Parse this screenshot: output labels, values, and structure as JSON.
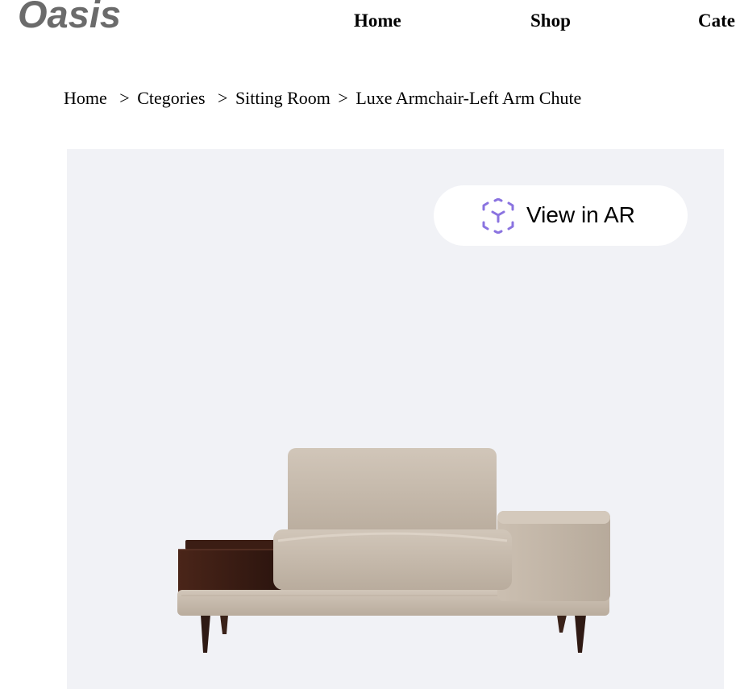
{
  "header": {
    "logo": "Oasis",
    "nav": {
      "home": "Home",
      "shop": "Shop",
      "categories": "Cate"
    }
  },
  "breadcrumb": {
    "items": [
      "Home",
      "Ctegories",
      "Sitting Room",
      "Luxe Armchair-Left Arm Chute"
    ],
    "separator": ">"
  },
  "product": {
    "ar_button_label": "View in AR",
    "ar_icon": "ar-cube-icon",
    "image": "armchair-photo",
    "colors": {
      "stage_background": "#f1f2f6",
      "ar_icon_accent": "#8a73e0",
      "upholstery": "#c8bcae",
      "wood": "#3f2017"
    }
  }
}
